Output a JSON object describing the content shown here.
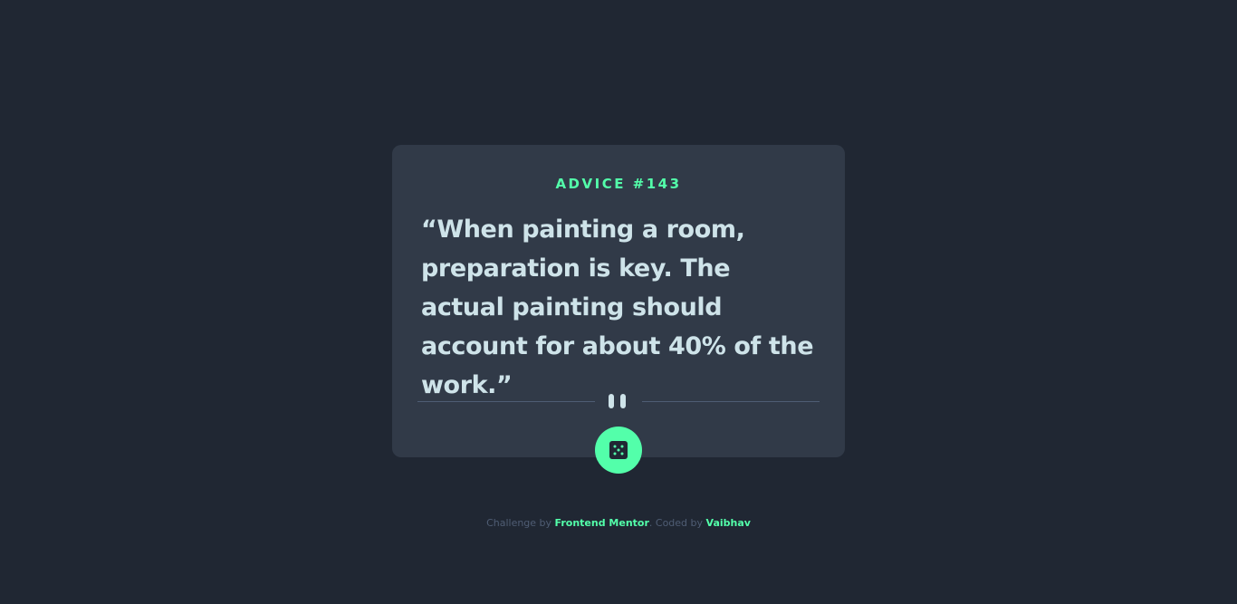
{
  "card": {
    "advice_label": "ADVICE #143",
    "quote": "“When painting a room, preparation is key. The actual painting should account for about 40% of the work.”"
  },
  "button": {
    "icon": "dice-icon"
  },
  "footer": {
    "prefix": "Challenge by ",
    "challenge_link": "Frontend Mentor",
    "middle": ". Coded by ",
    "author_link": "Vaibhav"
  },
  "colors": {
    "background": "#202733",
    "card": "#313a48",
    "accent": "#53ffaa",
    "text": "#cee3e9",
    "muted": "#4f5d74"
  }
}
